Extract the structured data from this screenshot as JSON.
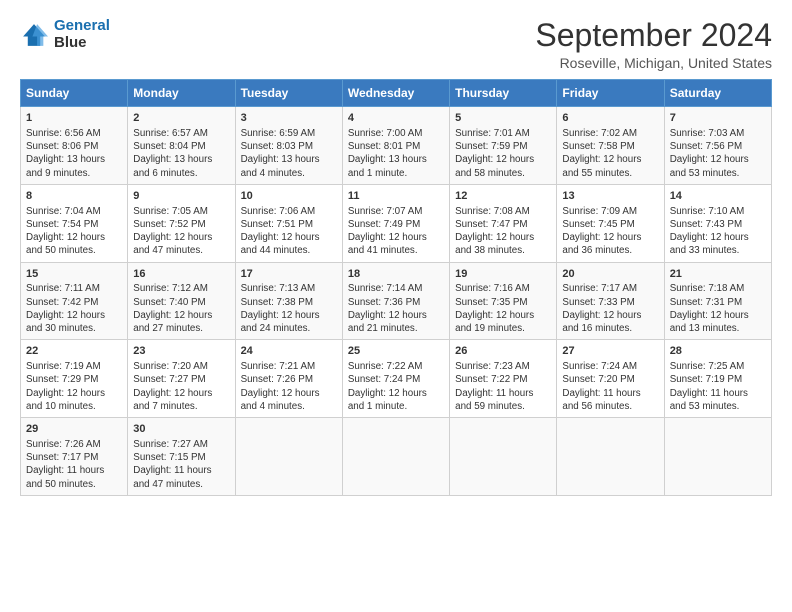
{
  "logo": {
    "line1": "General",
    "line2": "Blue"
  },
  "title": "September 2024",
  "subtitle": "Roseville, Michigan, United States",
  "headers": [
    "Sunday",
    "Monday",
    "Tuesday",
    "Wednesday",
    "Thursday",
    "Friday",
    "Saturday"
  ],
  "weeks": [
    [
      {
        "day": "1",
        "lines": [
          "Sunrise: 6:56 AM",
          "Sunset: 8:06 PM",
          "Daylight: 13 hours",
          "and 9 minutes."
        ]
      },
      {
        "day": "2",
        "lines": [
          "Sunrise: 6:57 AM",
          "Sunset: 8:04 PM",
          "Daylight: 13 hours",
          "and 6 minutes."
        ]
      },
      {
        "day": "3",
        "lines": [
          "Sunrise: 6:59 AM",
          "Sunset: 8:03 PM",
          "Daylight: 13 hours",
          "and 4 minutes."
        ]
      },
      {
        "day": "4",
        "lines": [
          "Sunrise: 7:00 AM",
          "Sunset: 8:01 PM",
          "Daylight: 13 hours",
          "and 1 minute."
        ]
      },
      {
        "day": "5",
        "lines": [
          "Sunrise: 7:01 AM",
          "Sunset: 7:59 PM",
          "Daylight: 12 hours",
          "and 58 minutes."
        ]
      },
      {
        "day": "6",
        "lines": [
          "Sunrise: 7:02 AM",
          "Sunset: 7:58 PM",
          "Daylight: 12 hours",
          "and 55 minutes."
        ]
      },
      {
        "day": "7",
        "lines": [
          "Sunrise: 7:03 AM",
          "Sunset: 7:56 PM",
          "Daylight: 12 hours",
          "and 53 minutes."
        ]
      }
    ],
    [
      {
        "day": "8",
        "lines": [
          "Sunrise: 7:04 AM",
          "Sunset: 7:54 PM",
          "Daylight: 12 hours",
          "and 50 minutes."
        ]
      },
      {
        "day": "9",
        "lines": [
          "Sunrise: 7:05 AM",
          "Sunset: 7:52 PM",
          "Daylight: 12 hours",
          "and 47 minutes."
        ]
      },
      {
        "day": "10",
        "lines": [
          "Sunrise: 7:06 AM",
          "Sunset: 7:51 PM",
          "Daylight: 12 hours",
          "and 44 minutes."
        ]
      },
      {
        "day": "11",
        "lines": [
          "Sunrise: 7:07 AM",
          "Sunset: 7:49 PM",
          "Daylight: 12 hours",
          "and 41 minutes."
        ]
      },
      {
        "day": "12",
        "lines": [
          "Sunrise: 7:08 AM",
          "Sunset: 7:47 PM",
          "Daylight: 12 hours",
          "and 38 minutes."
        ]
      },
      {
        "day": "13",
        "lines": [
          "Sunrise: 7:09 AM",
          "Sunset: 7:45 PM",
          "Daylight: 12 hours",
          "and 36 minutes."
        ]
      },
      {
        "day": "14",
        "lines": [
          "Sunrise: 7:10 AM",
          "Sunset: 7:43 PM",
          "Daylight: 12 hours",
          "and 33 minutes."
        ]
      }
    ],
    [
      {
        "day": "15",
        "lines": [
          "Sunrise: 7:11 AM",
          "Sunset: 7:42 PM",
          "Daylight: 12 hours",
          "and 30 minutes."
        ]
      },
      {
        "day": "16",
        "lines": [
          "Sunrise: 7:12 AM",
          "Sunset: 7:40 PM",
          "Daylight: 12 hours",
          "and 27 minutes."
        ]
      },
      {
        "day": "17",
        "lines": [
          "Sunrise: 7:13 AM",
          "Sunset: 7:38 PM",
          "Daylight: 12 hours",
          "and 24 minutes."
        ]
      },
      {
        "day": "18",
        "lines": [
          "Sunrise: 7:14 AM",
          "Sunset: 7:36 PM",
          "Daylight: 12 hours",
          "and 21 minutes."
        ]
      },
      {
        "day": "19",
        "lines": [
          "Sunrise: 7:16 AM",
          "Sunset: 7:35 PM",
          "Daylight: 12 hours",
          "and 19 minutes."
        ]
      },
      {
        "day": "20",
        "lines": [
          "Sunrise: 7:17 AM",
          "Sunset: 7:33 PM",
          "Daylight: 12 hours",
          "and 16 minutes."
        ]
      },
      {
        "day": "21",
        "lines": [
          "Sunrise: 7:18 AM",
          "Sunset: 7:31 PM",
          "Daylight: 12 hours",
          "and 13 minutes."
        ]
      }
    ],
    [
      {
        "day": "22",
        "lines": [
          "Sunrise: 7:19 AM",
          "Sunset: 7:29 PM",
          "Daylight: 12 hours",
          "and 10 minutes."
        ]
      },
      {
        "day": "23",
        "lines": [
          "Sunrise: 7:20 AM",
          "Sunset: 7:27 PM",
          "Daylight: 12 hours",
          "and 7 minutes."
        ]
      },
      {
        "day": "24",
        "lines": [
          "Sunrise: 7:21 AM",
          "Sunset: 7:26 PM",
          "Daylight: 12 hours",
          "and 4 minutes."
        ]
      },
      {
        "day": "25",
        "lines": [
          "Sunrise: 7:22 AM",
          "Sunset: 7:24 PM",
          "Daylight: 12 hours",
          "and 1 minute."
        ]
      },
      {
        "day": "26",
        "lines": [
          "Sunrise: 7:23 AM",
          "Sunset: 7:22 PM",
          "Daylight: 11 hours",
          "and 59 minutes."
        ]
      },
      {
        "day": "27",
        "lines": [
          "Sunrise: 7:24 AM",
          "Sunset: 7:20 PM",
          "Daylight: 11 hours",
          "and 56 minutes."
        ]
      },
      {
        "day": "28",
        "lines": [
          "Sunrise: 7:25 AM",
          "Sunset: 7:19 PM",
          "Daylight: 11 hours",
          "and 53 minutes."
        ]
      }
    ],
    [
      {
        "day": "29",
        "lines": [
          "Sunrise: 7:26 AM",
          "Sunset: 7:17 PM",
          "Daylight: 11 hours",
          "and 50 minutes."
        ]
      },
      {
        "day": "30",
        "lines": [
          "Sunrise: 7:27 AM",
          "Sunset: 7:15 PM",
          "Daylight: 11 hours",
          "and 47 minutes."
        ]
      },
      null,
      null,
      null,
      null,
      null
    ]
  ]
}
